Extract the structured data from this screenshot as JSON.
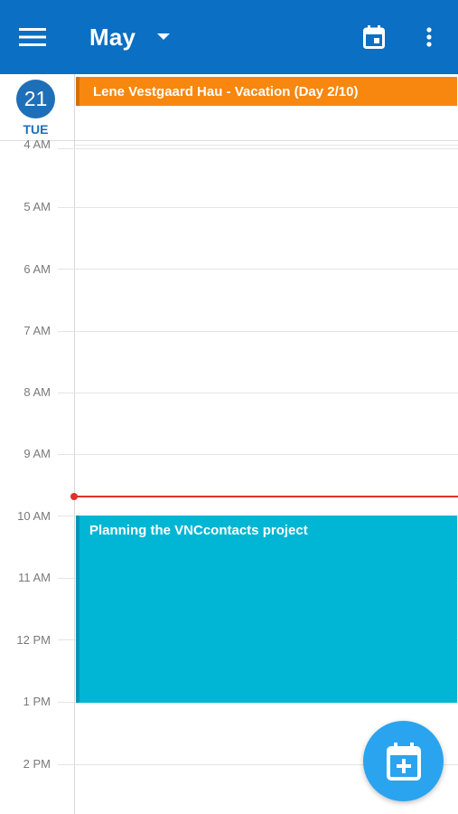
{
  "app_bar": {
    "menu_icon": "hamburger-menu-icon",
    "month": "May",
    "month_dropdown_icon": "caret-down-icon",
    "today_icon": "calendar-today-icon",
    "more_icon": "more-vert-icon",
    "background_color": "#0b6fc3"
  },
  "day_header": {
    "day_number": "21",
    "day_of_week": "TUE",
    "accent_color": "#1e6fb8"
  },
  "all_day_events": [
    {
      "title": "Lene Vestgaard Hau - Vacation (Day 2/10)",
      "color": "#f7870f"
    }
  ],
  "hours": [
    "4 AM",
    "5 AM",
    "6 AM",
    "7 AM",
    "8 AM",
    "9 AM",
    "10 AM",
    "11 AM",
    "12 PM",
    "1 PM",
    "2 PM"
  ],
  "events": [
    {
      "title": "Planning the VNCcontacts project",
      "color": "#00b6d4"
    }
  ],
  "current_time_indicator_color": "#e0312a",
  "fab": {
    "icon": "add-event-icon",
    "color": "#2aa4ee"
  }
}
